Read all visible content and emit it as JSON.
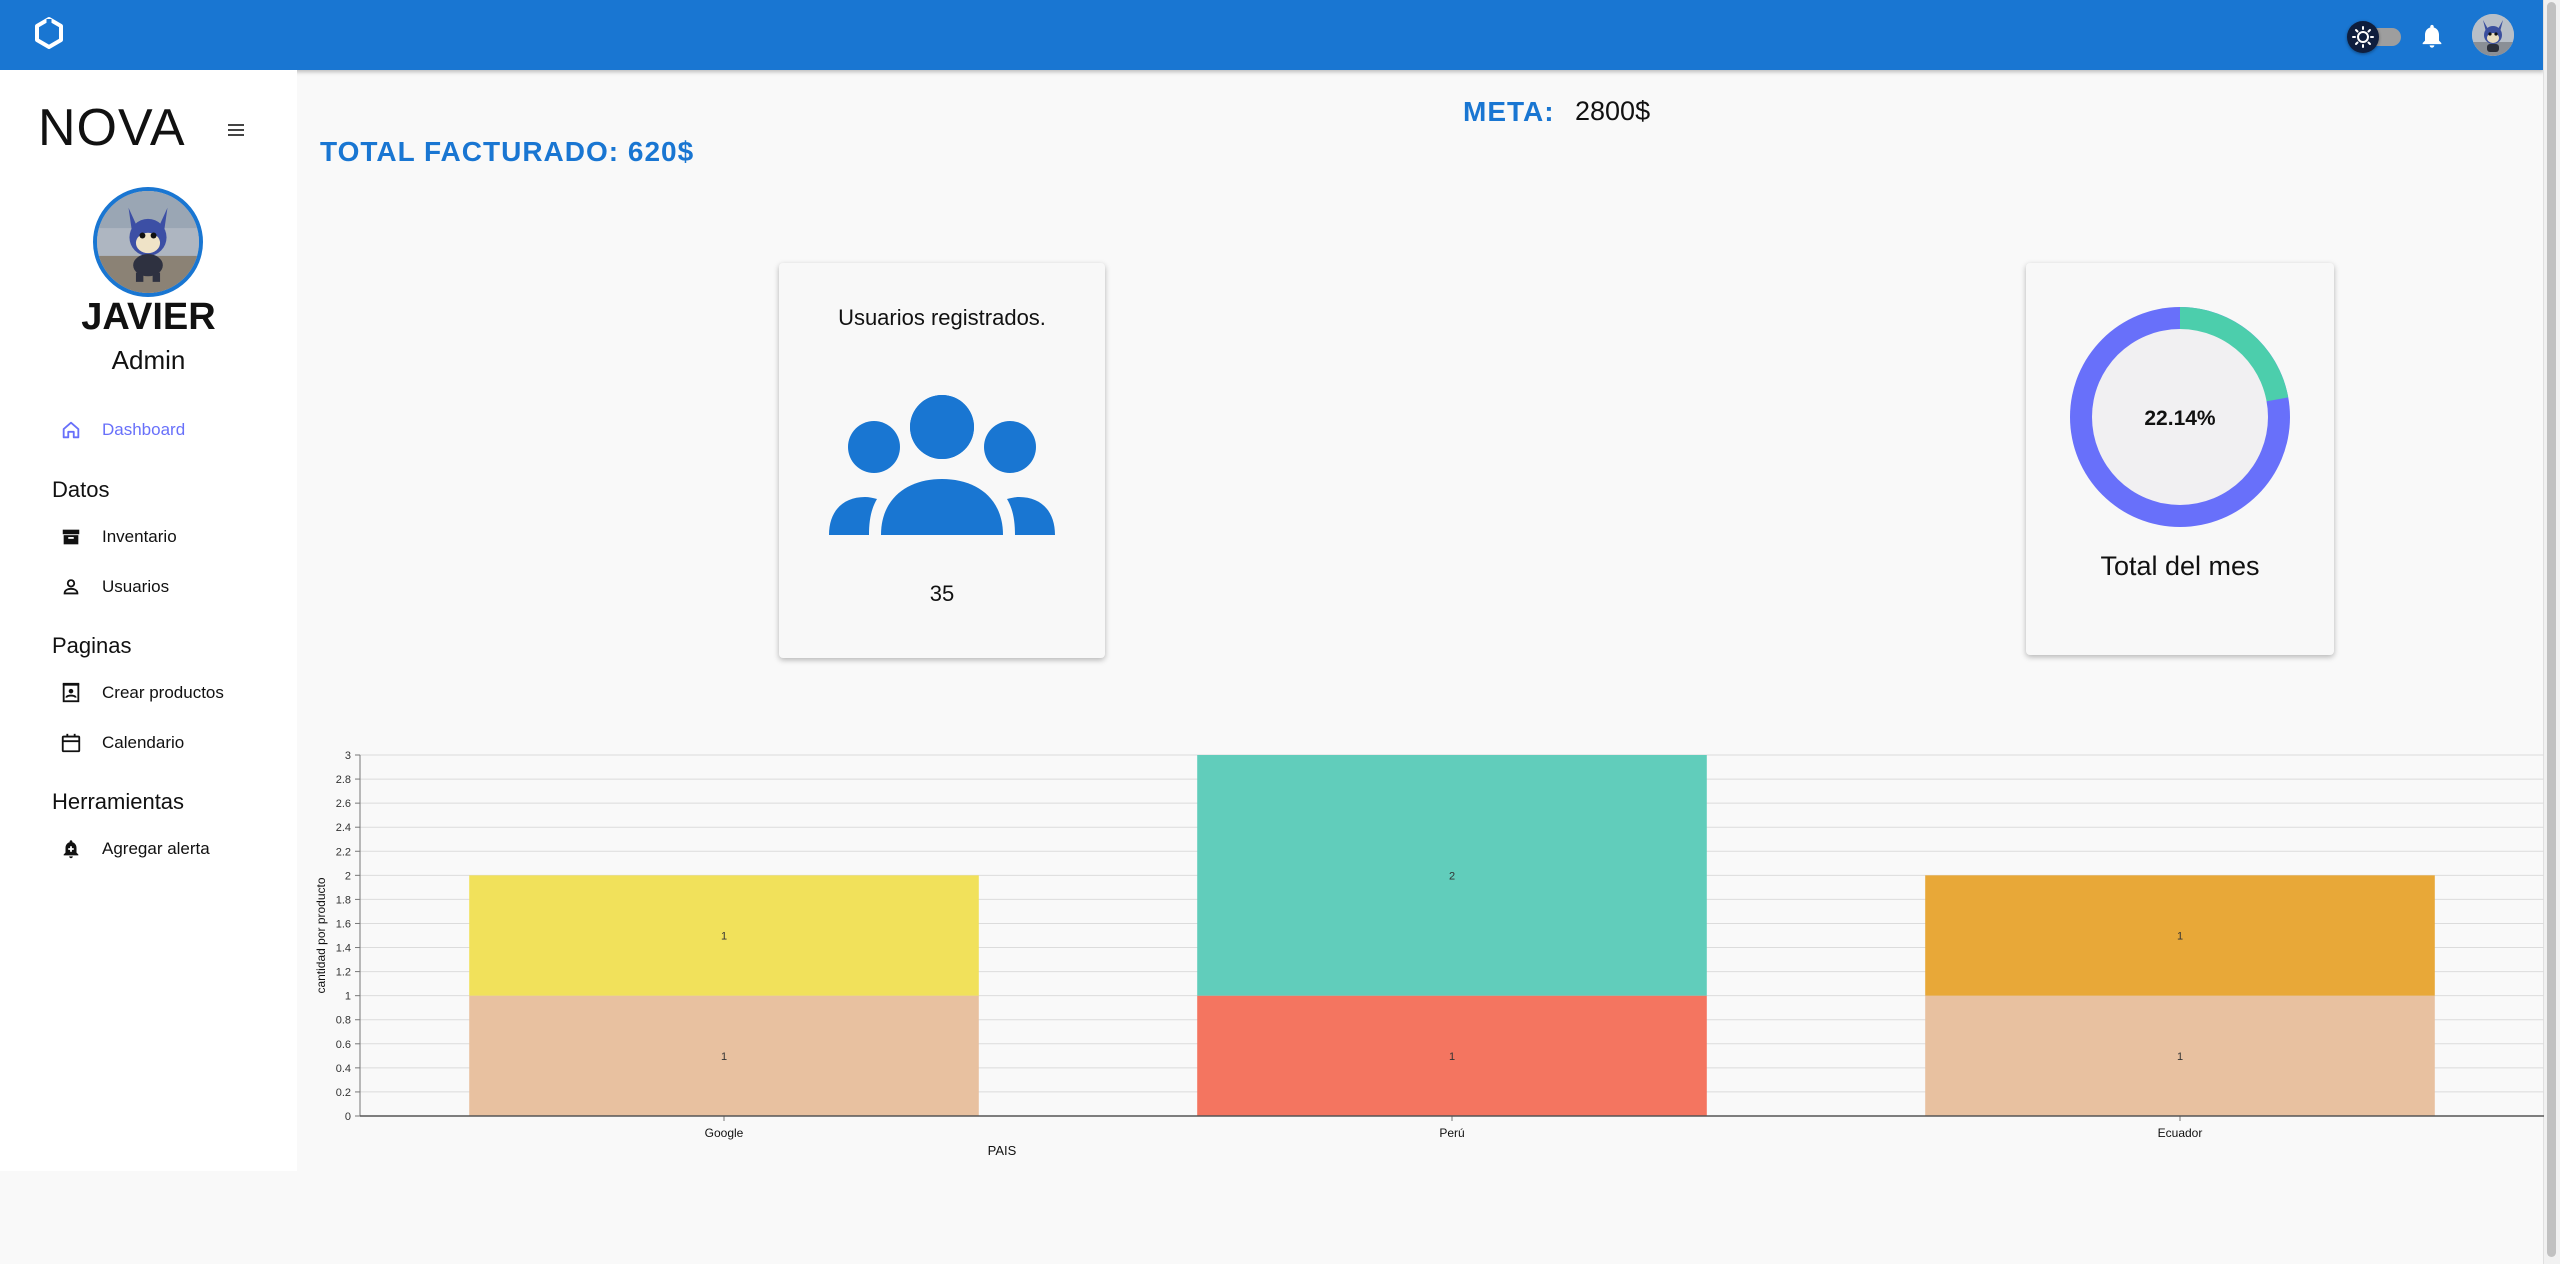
{
  "topbar": {
    "logo_icon": "app-logo-icon",
    "theme_toggle_icon": "sun-icon",
    "notifications_icon": "bell-icon",
    "color": "#1976d2"
  },
  "sidebar": {
    "brand": "NOVA",
    "user": {
      "name": "JAVIER",
      "role": "Admin"
    },
    "items": [
      {
        "label": "Dashboard",
        "icon": "home-icon",
        "active": true
      }
    ],
    "sections": [
      {
        "title": "Datos",
        "items": [
          {
            "label": "Inventario",
            "icon": "archive-icon"
          },
          {
            "label": "Usuarios",
            "icon": "person-icon"
          }
        ]
      },
      {
        "title": "Paginas",
        "items": [
          {
            "label": "Crear productos",
            "icon": "contact-page-icon"
          },
          {
            "label": "Calendario",
            "icon": "calendar-icon"
          }
        ]
      },
      {
        "title": "Herramientas",
        "items": [
          {
            "label": "Agregar alerta",
            "icon": "add-alert-icon"
          }
        ]
      }
    ]
  },
  "main": {
    "meta_label": "META:",
    "meta_value": "2800$",
    "total_label": "TOTAL FACTURADO: 620$",
    "users_card": {
      "title": "Usuarios registrados.",
      "count": "35",
      "icon": "group-icon"
    },
    "total_card": {
      "percent": "22.14%",
      "progress": 0.2214,
      "caption": "Total del mes"
    }
  },
  "chart_data": {
    "type": "bar",
    "stacked": true,
    "categories": [
      "Google",
      "Perú",
      "Ecuador"
    ],
    "xlabel": "PAIS",
    "ylabel": "cantidad por producto",
    "ylim": [
      0,
      3
    ],
    "yticks": [
      "0",
      "0.2",
      "0.4",
      "0.6",
      "0.8",
      "1",
      "1.2",
      "1.4",
      "1.6",
      "1.8",
      "2",
      "2.2",
      "2.4",
      "2.6",
      "2.8",
      "3"
    ],
    "grid": true,
    "segments": [
      {
        "category": "Google",
        "values": [
          1,
          1
        ],
        "colors": [
          "#e8c1a0",
          "#f1e15b"
        ],
        "labels": [
          "1",
          "1"
        ]
      },
      {
        "category": "Perú",
        "values": [
          1,
          2
        ],
        "colors": [
          "#f47560",
          "#61cdbb"
        ],
        "labels": [
          "1",
          "2"
        ]
      },
      {
        "category": "Ecuador",
        "values": [
          1,
          1
        ],
        "colors": [
          "#e8c1a0",
          "#e8a838"
        ],
        "labels": [
          "1",
          "1"
        ]
      }
    ]
  }
}
